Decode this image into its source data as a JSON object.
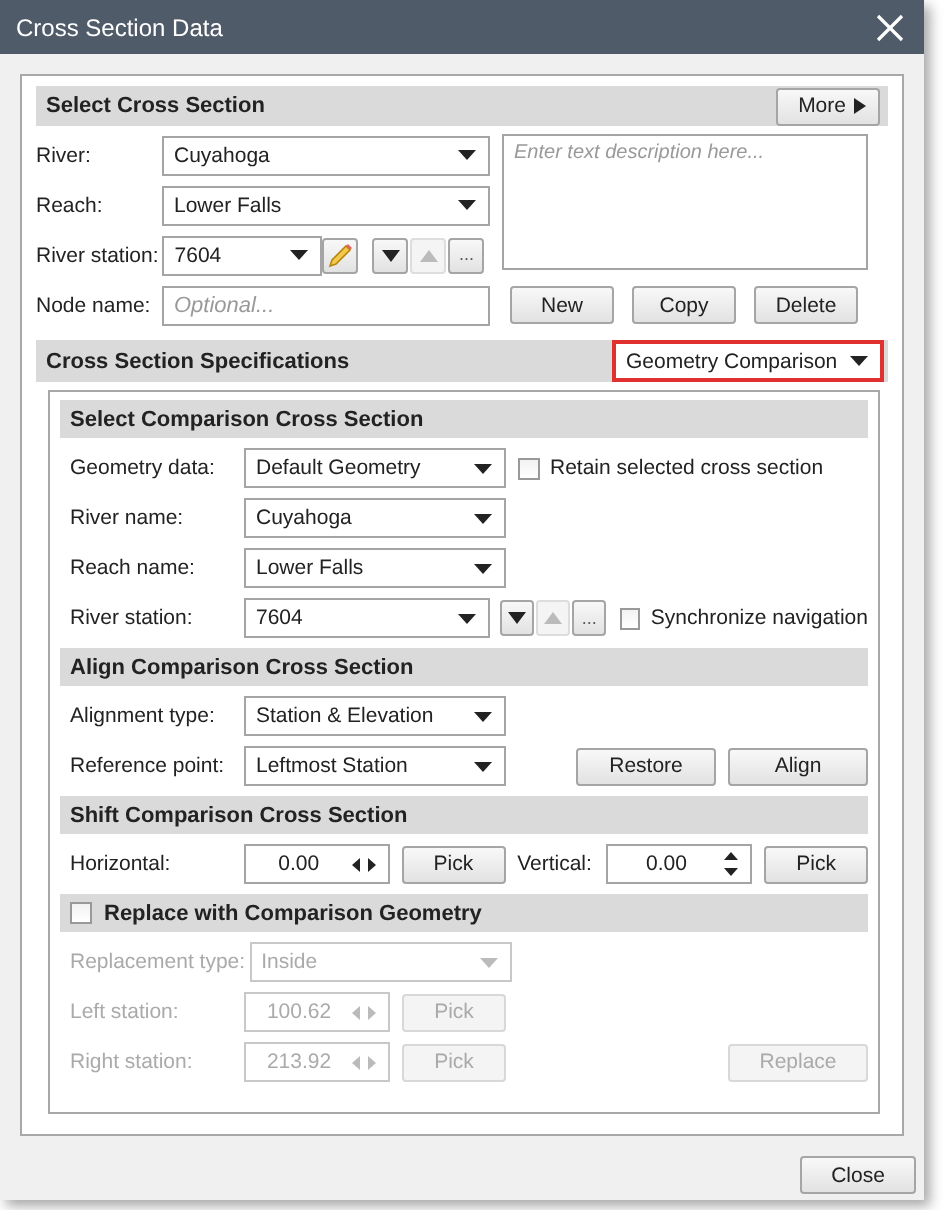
{
  "window": {
    "title": "Cross Section Data"
  },
  "select_cross_section": {
    "header": "Select Cross Section",
    "more_button": "More",
    "river": {
      "label": "River:",
      "value": "Cuyahoga"
    },
    "reach": {
      "label": "Reach:",
      "value": "Lower Falls"
    },
    "river_station": {
      "label": "River station:",
      "value": "7604",
      "browse": "...",
      "up_disabled": true
    },
    "node_name": {
      "label": "Node name:",
      "placeholder": "Optional..."
    },
    "description": {
      "placeholder": "Enter text description here..."
    },
    "buttons": [
      "New",
      "Copy",
      "Delete"
    ]
  },
  "specifications": {
    "header": "Cross Section Specifications",
    "mode": {
      "value": "Geometry Comparison",
      "highlighted": true
    }
  },
  "comparison": {
    "header": "Select Comparison Cross Section",
    "rows": [
      {
        "kind": "dropdown",
        "label": "Geometry data:",
        "value": "Default Geometry",
        "checkbox": {
          "label": "Retain selected cross section",
          "checked": false
        }
      },
      {
        "kind": "dropdown",
        "label": "River name:",
        "value": "Cuyahoga"
      },
      {
        "kind": "dropdown",
        "label": "Reach name:",
        "value": "Lower Falls"
      },
      {
        "kind": "station",
        "label": "River station:",
        "value": "7604",
        "browse": "...",
        "up_disabled": true,
        "checkbox": {
          "label": "Synchronize navigation",
          "checked": false
        }
      }
    ]
  },
  "align": {
    "header": "Align Comparison Cross Section",
    "rows": [
      {
        "label": "Alignment type:",
        "value": "Station & Elevation"
      },
      {
        "label": "Reference point:",
        "value": "Leftmost Station"
      }
    ],
    "buttons": [
      "Restore",
      "Align"
    ]
  },
  "shift": {
    "header": "Shift Comparison Cross Section",
    "horizontal": {
      "label": "Horizontal:",
      "value": "0.00",
      "pick": "Pick"
    },
    "vertical": {
      "label": "Vertical:",
      "value": "0.00",
      "pick": "Pick"
    }
  },
  "replace": {
    "header": "Replace with Comparison Geometry",
    "checked": false,
    "type": {
      "label": "Replacement type:",
      "value": "Inside"
    },
    "stations": [
      {
        "label": "Left station:",
        "value": "100.62",
        "pick": "Pick"
      },
      {
        "label": "Right station:",
        "value": "213.92",
        "pick": "Pick"
      }
    ],
    "button": "Replace"
  },
  "footer": {
    "close": "Close"
  }
}
